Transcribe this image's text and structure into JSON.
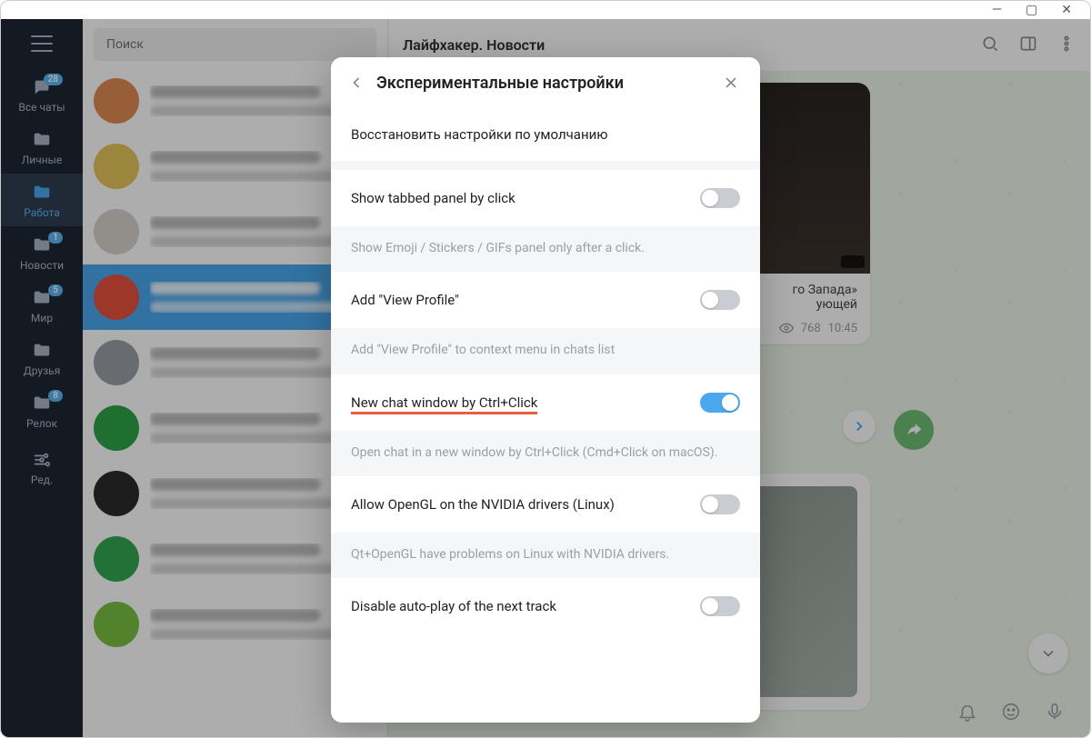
{
  "window": {
    "minimize": "—",
    "maximize": "▢",
    "close": "✕"
  },
  "rail": {
    "items": [
      {
        "label": "Все чаты",
        "badge": "28",
        "icon": "chats"
      },
      {
        "label": "Личные",
        "icon": "folder"
      },
      {
        "label": "Работа",
        "icon": "folder",
        "active": true
      },
      {
        "label": "Новости",
        "icon": "folder",
        "badge": "1"
      },
      {
        "label": "Мир",
        "icon": "folder",
        "badge": "5"
      },
      {
        "label": "Друзья",
        "icon": "folder"
      },
      {
        "label": "Релок",
        "icon": "folder",
        "badge": "8"
      }
    ],
    "edit_label": "Ред."
  },
  "search": {
    "placeholder": "Поиск"
  },
  "chat_list_avatars": [
    "#e08b53",
    "#e6c65a",
    "#d7d2cc",
    "#e7513e",
    "#9aa0a6",
    "#2fa547",
    "#2b2b2b",
    "#33a852",
    "#7ac142"
  ],
  "chat_header": {
    "title": "Лайфхакер. Новости"
  },
  "message": {
    "text_line1": "го Запада»",
    "text_line2": "ующей",
    "views": "768",
    "time": "10:45"
  },
  "modal": {
    "title": "Экспериментальные настройки",
    "restore": "Восстановить настройки по умолчанию",
    "options": [
      {
        "label": "Show tabbed panel by click",
        "desc": "Show Emoji / Stickers / GIFs panel only after a click.",
        "on": false
      },
      {
        "label": "Add \"View Profile\"",
        "desc": "Add \"View Profile\" to context menu in chats list",
        "on": false
      },
      {
        "label": "New chat window by Ctrl+Click",
        "desc": "Open chat in a new window by Ctrl+Click (Cmd+Click on macOS).",
        "on": true,
        "highlight": true
      },
      {
        "label": "Allow OpenGL on the NVIDIA drivers (Linux)",
        "desc": "Qt+OpenGL have problems on Linux with NVIDIA drivers.",
        "on": false
      },
      {
        "label": "Disable auto-play of the next track",
        "desc": "",
        "on": false
      }
    ]
  }
}
